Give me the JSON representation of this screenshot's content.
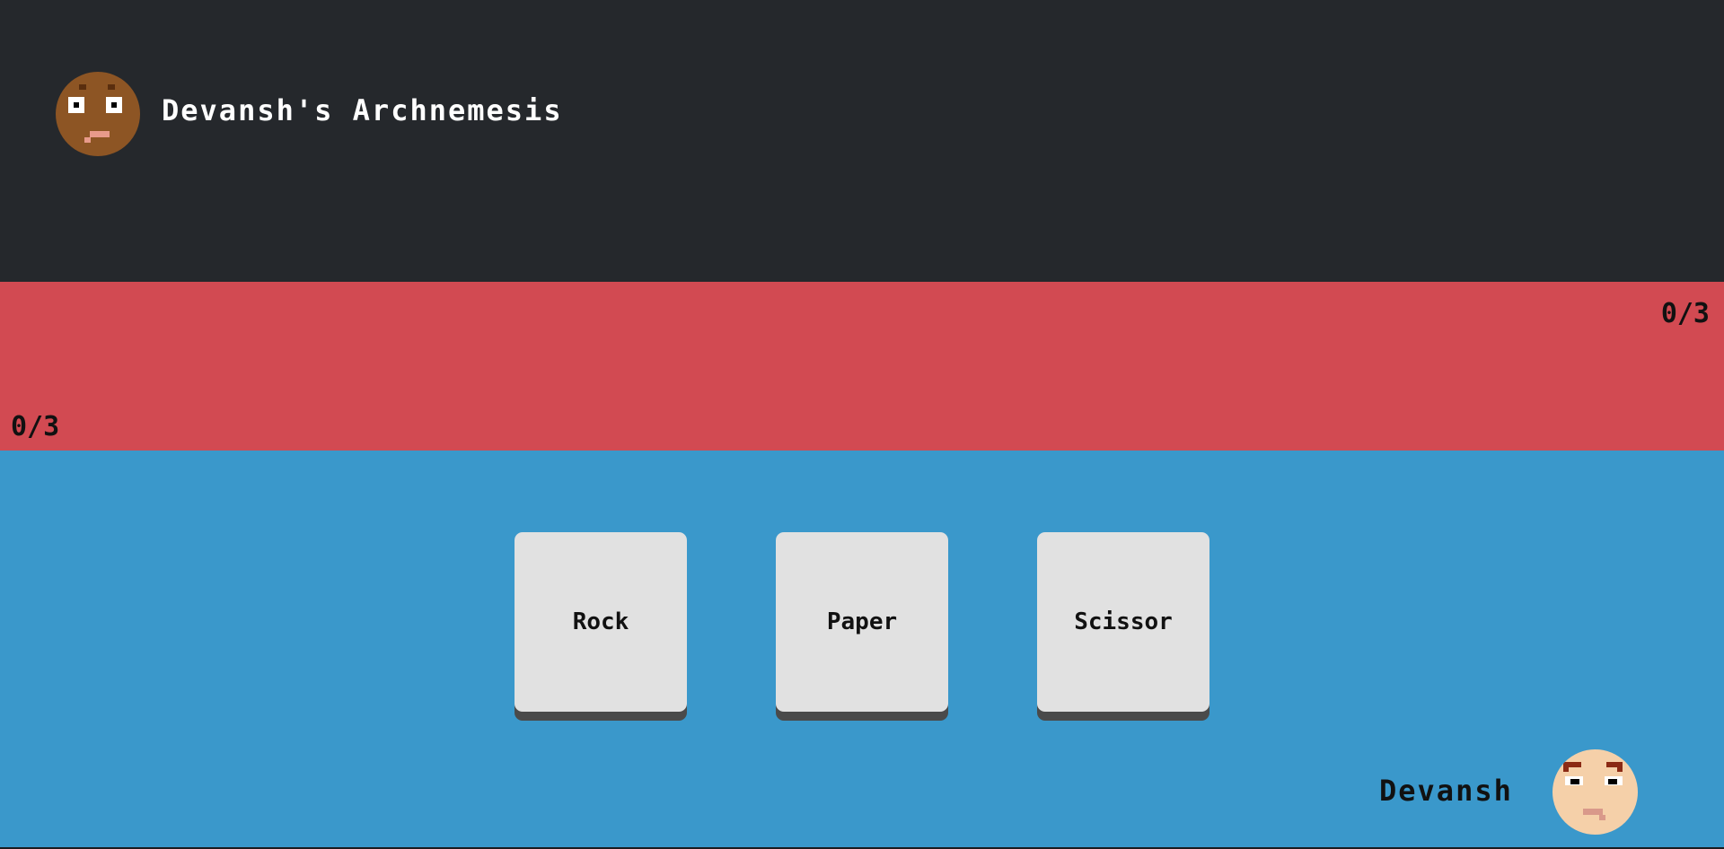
{
  "opponent": {
    "name": "Devansh's Archnemesis",
    "avatar_icon": "pixel-face-opponent-icon",
    "score": "0/3"
  },
  "player": {
    "name": "Devansh",
    "avatar_icon": "pixel-face-player-icon",
    "score": "0/3"
  },
  "choices": {
    "rock": "Rock",
    "paper": "Paper",
    "scissor": "Scissor"
  },
  "colors": {
    "opponent_bg": "#25282c",
    "battle_bg": "#d24a52",
    "player_bg": "#3a98cb",
    "button_bg": "#e1e1e1",
    "button_shadow": "#4a4a4a"
  }
}
